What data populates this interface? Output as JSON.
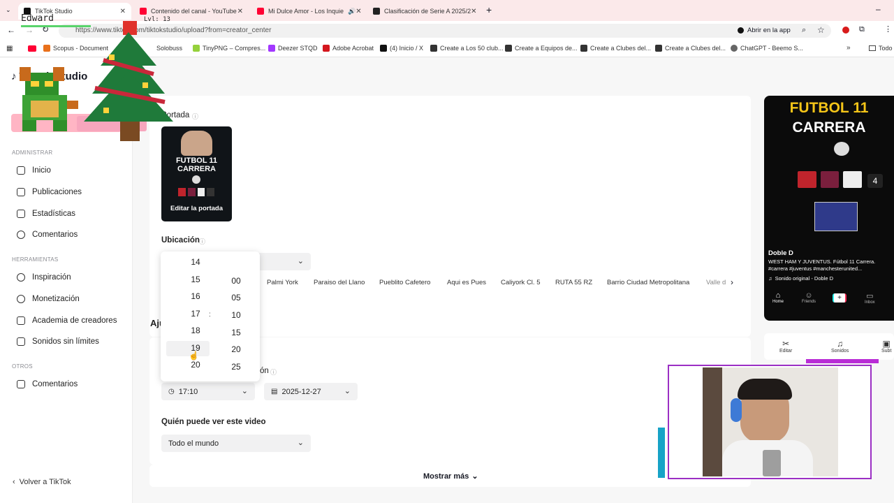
{
  "browser": {
    "tabs": [
      {
        "title": "TikTok Studio",
        "color": "#111111"
      },
      {
        "title": "Contenido del canal - YouTube",
        "color": "#ff0033"
      },
      {
        "title": "Mi Dulce Amor - Los Inquie",
        "color": "#ff0033"
      },
      {
        "title": "Clasificación de Serie A 2025/2",
        "color": "#222222"
      }
    ],
    "url": "https://www.tiktok.com/tiktokstudio/upload?from=creator_center",
    "open_in_app": "Abrir en la app",
    "bookmarks": [
      "Scopus - Document",
      "Solobuss",
      "TinyPNG – Compres...",
      "Deezer STQD",
      "Adobe Acrobat",
      "(4) Inicio / X",
      "Create a Los 50 club...",
      "Create a Equipos de...",
      "Create a Clubes del...",
      "Create a Clubes del...",
      "ChatGPT - Beemo S..."
    ],
    "all_bookmarks": "Todo"
  },
  "overlay": {
    "name": "Edward",
    "level": "Lvl: 13"
  },
  "sidebar": {
    "brand": "TikTok Studio",
    "section_admin": "ADMINISTRAR",
    "admin_items": [
      "Inicio",
      "Publicaciones",
      "Estadísticas",
      "Comentarios"
    ],
    "section_tools": "HERRAMIENTAS",
    "tool_items": [
      "Inspiración",
      "Monetización",
      "Academia de creadores",
      "Sonidos sin límites"
    ],
    "section_other": "OTROS",
    "other_items": [
      "Comentarios"
    ],
    "back": "Volver a TikTok"
  },
  "form": {
    "cover_label": "Portada",
    "cover_title_1": "FUTBOL 11",
    "cover_title_2": "CARRERA",
    "edit_cover": "Editar la portada",
    "location_label": "Ubicación",
    "location_chips": [
      "Palmi York",
      "Paraiso del Llano",
      "Pueblito Cafetero",
      "Aqui es Pues",
      "Caliyork Cl. 5",
      "RUTA 55 RZ",
      "Barrio Ciudad Metropolitana",
      "Valle d"
    ],
    "settings_heading": "Aju",
    "schedule_label": "ón",
    "time_value": "17:10",
    "date_value": "2025-12-27",
    "audience_label": "Quién puede ver este video",
    "audience_value": "Todo el mundo",
    "show_more": "Mostrar más"
  },
  "time_picker": {
    "hours": [
      "14",
      "15",
      "16",
      "17",
      "18",
      "19",
      "20"
    ],
    "minutes": [
      "00",
      "05",
      "10",
      "15",
      "20",
      "25"
    ],
    "separator": ":",
    "highlighted_hour": "19"
  },
  "preview": {
    "title_1": "FUTBOL 11",
    "title_2": "CARRERA",
    "score": "4",
    "account": "Doble D",
    "caption": "WEST HAM Y JUVENTUS. Fútbol 11 Carrera. #carrera #juventus #manchesterunited...",
    "sound": "Sonido original - Doble D",
    "nav": [
      "Home",
      "Friends",
      "Inbox"
    ],
    "tools": [
      "Editar",
      "Sonidos",
      "Subt"
    ]
  }
}
